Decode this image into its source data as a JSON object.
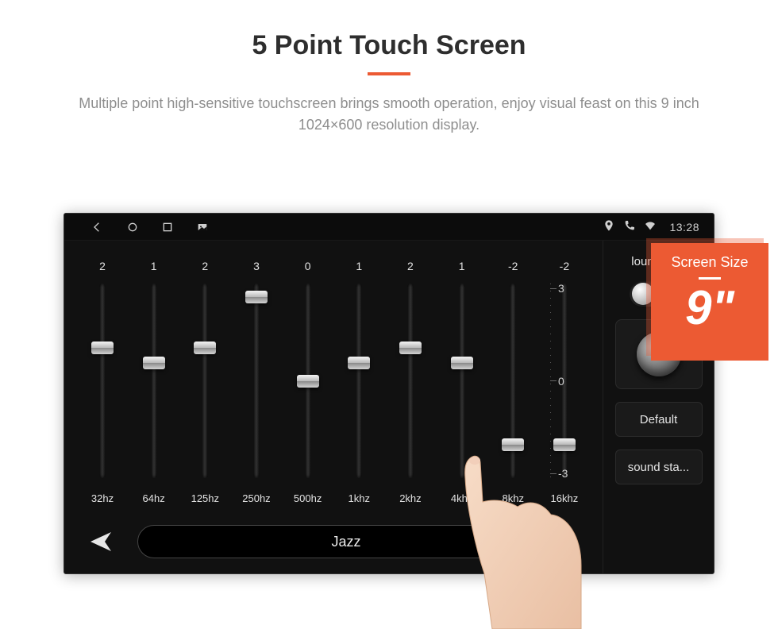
{
  "page": {
    "title": "5 Point Touch Screen",
    "subtitle": "Multiple point high-sensitive touchscreen brings smooth operation, enjoy visual feast on this 9 inch 1024×600 resolution display."
  },
  "statusbar": {
    "clock": "13:28"
  },
  "equalizer": {
    "scale": {
      "max": "3",
      "mid": "0",
      "min": "-3"
    },
    "bands": [
      {
        "value": "2",
        "pos": 33,
        "label": "32hz"
      },
      {
        "value": "1",
        "pos": 41,
        "label": "64hz"
      },
      {
        "value": "2",
        "pos": 33,
        "label": "125hz"
      },
      {
        "value": "3",
        "pos": 7,
        "label": "250hz"
      },
      {
        "value": "0",
        "pos": 50,
        "label": "500hz"
      },
      {
        "value": "1",
        "pos": 41,
        "label": "1khz"
      },
      {
        "value": "2",
        "pos": 33,
        "label": "2khz"
      },
      {
        "value": "1",
        "pos": 41,
        "label": "4khz"
      },
      {
        "value": "-2",
        "pos": 83,
        "label": "8khz"
      },
      {
        "value": "-2",
        "pos": 83,
        "label": "16khz"
      }
    ],
    "preset": "Jazz"
  },
  "side": {
    "loudness_label": "loundness",
    "default_label": "Default",
    "sound_label": "sound sta..."
  },
  "badge": {
    "title": "Screen Size",
    "value": "9\""
  }
}
